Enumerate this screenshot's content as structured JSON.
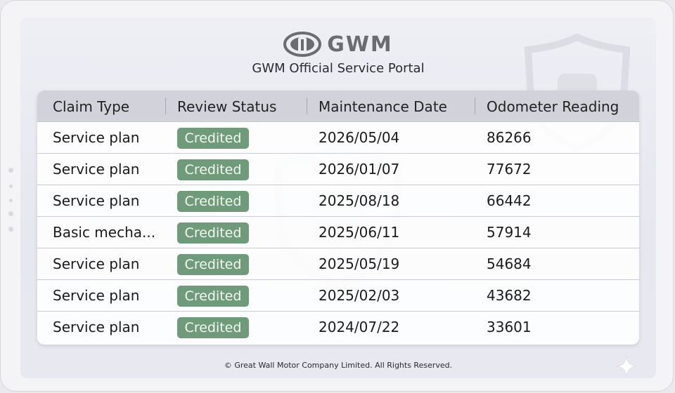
{
  "brand": {
    "logo_text": "GWM",
    "portal_title": "GWM Official Service Portal"
  },
  "table": {
    "headers": [
      "Claim Type",
      "Review Status",
      "Maintenance Date",
      "Odometer Reading"
    ],
    "rows": [
      {
        "claim_type": "Service plan",
        "status": "Credited",
        "date": "2026/05/04",
        "odometer": "86266"
      },
      {
        "claim_type": "Service plan",
        "status": "Credited",
        "date": "2026/01/07",
        "odometer": "77672"
      },
      {
        "claim_type": "Service plan",
        "status": "Credited",
        "date": "2025/08/18",
        "odometer": "66442"
      },
      {
        "claim_type": "Basic mecha...",
        "status": "Credited",
        "date": "2025/06/11",
        "odometer": "57914"
      },
      {
        "claim_type": "Service plan",
        "status": "Credited",
        "date": "2025/05/19",
        "odometer": "54684"
      },
      {
        "claim_type": "Service plan",
        "status": "Credited",
        "date": "2025/02/03",
        "odometer": "43682"
      },
      {
        "claim_type": "Service plan",
        "status": "Credited",
        "date": "2024/07/22",
        "odometer": "33601"
      }
    ]
  },
  "footer": {
    "copyright": "© Great Wall Motor Company Limited. All Rights Reserved."
  },
  "colors": {
    "status_badge": "#6f9b7a",
    "header_bg": "#d2d3da",
    "logo_gray": "#6a6c72"
  }
}
